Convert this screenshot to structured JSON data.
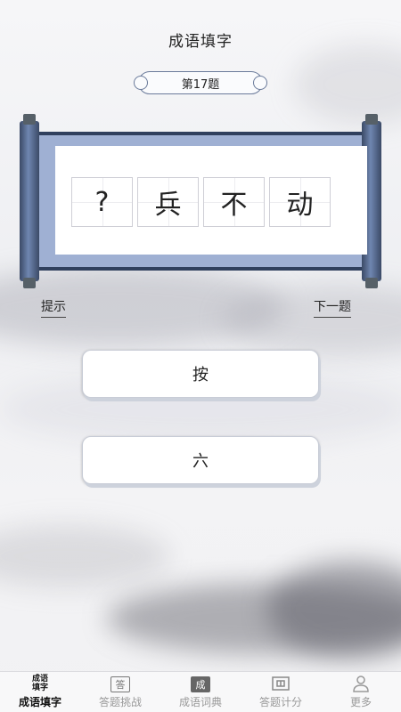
{
  "header": {
    "title": "成语填字"
  },
  "question": {
    "label": "第17题"
  },
  "puzzle": {
    "chars": [
      "?",
      "兵",
      "不",
      "动"
    ]
  },
  "actions": {
    "hint": "提示",
    "next": "下一题"
  },
  "options": [
    "按",
    "六"
  ],
  "nav": {
    "active_icon_text": "成语\n填字",
    "items": [
      {
        "label": "成语填字",
        "icon": "idiom-fill-icon",
        "active": true
      },
      {
        "label": "答题挑战",
        "icon": "answer-challenge-icon",
        "icon_text": "答"
      },
      {
        "label": "成语词典",
        "icon": "dictionary-icon",
        "icon_text": "成"
      },
      {
        "label": "答题计分",
        "icon": "score-icon"
      },
      {
        "label": "更多",
        "icon": "person-icon"
      }
    ]
  }
}
